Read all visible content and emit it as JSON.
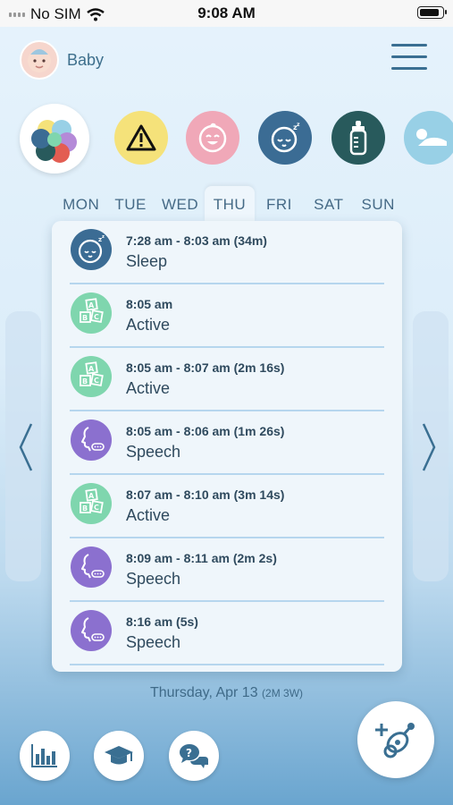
{
  "status_bar": {
    "carrier": "No SIM",
    "time": "9:08 AM",
    "battery_level": 0.9
  },
  "header": {
    "baby_name": "Baby"
  },
  "categories": [
    "all-activities",
    "alerts",
    "face",
    "sleep",
    "feeding",
    "tummy-time"
  ],
  "week": {
    "days": [
      "MON",
      "TUE",
      "WED",
      "THU",
      "FRI",
      "SAT",
      "SUN"
    ],
    "selected": "THU"
  },
  "entries": [
    {
      "time": "7:28 am - 8:03 am (34m)",
      "type": "Sleep",
      "icon": "sleep-icon",
      "color": "#3b6c94"
    },
    {
      "time": "8:05 am",
      "type": "Active",
      "icon": "blocks-icon",
      "color": "#7fd6ae"
    },
    {
      "time": "8:05 am - 8:07 am (2m 16s)",
      "type": "Active",
      "icon": "blocks-icon",
      "color": "#7fd6ae"
    },
    {
      "time": "8:05 am - 8:06 am (1m 26s)",
      "type": "Speech",
      "icon": "speech-icon",
      "color": "#8b70cf"
    },
    {
      "time": "8:07 am - 8:10 am (3m 14s)",
      "type": "Active",
      "icon": "blocks-icon",
      "color": "#7fd6ae"
    },
    {
      "time": "8:09 am - 8:11 am (2m 2s)",
      "type": "Speech",
      "icon": "speech-icon",
      "color": "#8b70cf"
    },
    {
      "time": "8:16 am (5s)",
      "type": "Speech",
      "icon": "speech-icon",
      "color": "#8b70cf"
    }
  ],
  "footer": {
    "date": "Thursday, Apr 13",
    "age": "(2M 3W)"
  }
}
